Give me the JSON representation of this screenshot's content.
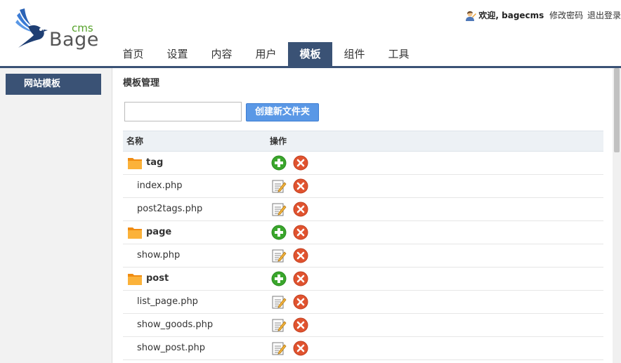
{
  "logo": {
    "small": "cms",
    "big": "Bage"
  },
  "userbar": {
    "welcome": "欢迎, bagecms",
    "change_password": "修改密码",
    "logout": "退出登录"
  },
  "nav": {
    "items": [
      {
        "label": "首页"
      },
      {
        "label": "设置"
      },
      {
        "label": "内容"
      },
      {
        "label": "用户"
      },
      {
        "label": "模板"
      },
      {
        "label": "组件"
      },
      {
        "label": "工具"
      }
    ],
    "active_index": 4
  },
  "sidebar": {
    "items": [
      {
        "label": "网站模板"
      }
    ]
  },
  "main": {
    "title": "模板管理",
    "folder_input": {
      "value": "",
      "placeholder": ""
    },
    "create_button": "创建新文件夹",
    "table": {
      "headers": {
        "name": "名称",
        "actions": "操作"
      },
      "rows": [
        {
          "type": "folder",
          "name": "tag"
        },
        {
          "type": "file",
          "name": "index.php"
        },
        {
          "type": "file",
          "name": "post2tags.php"
        },
        {
          "type": "folder",
          "name": "page"
        },
        {
          "type": "file",
          "name": "show.php"
        },
        {
          "type": "folder",
          "name": "post"
        },
        {
          "type": "file",
          "name": "list_page.php"
        },
        {
          "type": "file",
          "name": "show_goods.php"
        },
        {
          "type": "file",
          "name": "show_post.php"
        }
      ]
    }
  },
  "icons": {
    "folder": "folder-icon",
    "add": "add-icon",
    "edit": "edit-icon",
    "delete": "delete-icon",
    "user": "user-icon"
  },
  "colors": {
    "nav_active": "#3a5275",
    "button": "#5a98e6",
    "add": "#3aa62c",
    "delete": "#e0532f",
    "folder": "#f7a21d"
  }
}
